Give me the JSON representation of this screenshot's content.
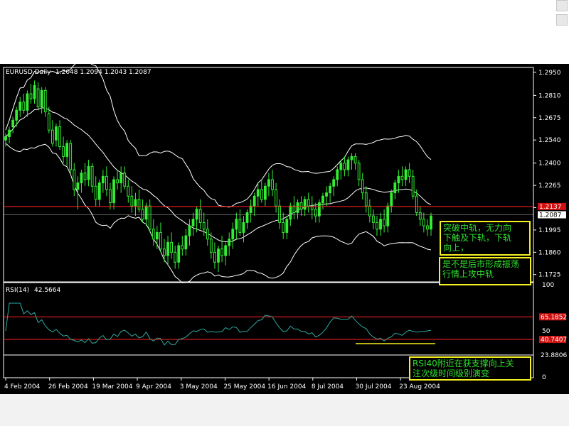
{
  "chart_data": {
    "type": "candlestick",
    "symbol_label": "EURUSD,Daily",
    "ohlc_label": "1.2048 1.2094 1.2043 1.2087",
    "price_ylim": [
      1.1685,
      1.2975
    ],
    "price_ticks": [
      "1.2950",
      "1.2810",
      "1.2675",
      "1.2540",
      "1.2400",
      "1.2265",
      "1.2130",
      "1.1995",
      "1.1860",
      "1.1725"
    ],
    "price_tick_values": [
      1.295,
      1.281,
      1.2675,
      1.254,
      1.24,
      1.2265,
      1.213,
      1.1995,
      1.186,
      1.1725
    ],
    "red_level_label": "1.2137",
    "red_level": 1.2137,
    "current_label": "1.2087",
    "current_price": 1.2087,
    "candles": [
      [
        1.254,
        1.258,
        1.25,
        1.256
      ],
      [
        1.256,
        1.262,
        1.252,
        1.26
      ],
      [
        1.262,
        1.268,
        1.258,
        1.266
      ],
      [
        1.266,
        1.274,
        1.262,
        1.272
      ],
      [
        1.272,
        1.28,
        1.268,
        1.277
      ],
      [
        1.277,
        1.282,
        1.27,
        1.272
      ],
      [
        1.272,
        1.284,
        1.268,
        1.282
      ],
      [
        1.282,
        1.288,
        1.276,
        1.279
      ],
      [
        1.279,
        1.29,
        1.276,
        1.287
      ],
      [
        1.285,
        1.289,
        1.272,
        1.274
      ],
      [
        1.274,
        1.286,
        1.27,
        1.284
      ],
      [
        1.284,
        1.286,
        1.268,
        1.271
      ],
      [
        1.27,
        1.274,
        1.258,
        1.26
      ],
      [
        1.26,
        1.266,
        1.25,
        1.252
      ],
      [
        1.254,
        1.264,
        1.25,
        1.262
      ],
      [
        1.262,
        1.266,
        1.248,
        1.25
      ],
      [
        1.25,
        1.256,
        1.24,
        1.244
      ],
      [
        1.244,
        1.254,
        1.238,
        1.252
      ],
      [
        1.252,
        1.254,
        1.234,
        1.236
      ],
      [
        1.236,
        1.24,
        1.22,
        1.224
      ],
      [
        1.224,
        1.232,
        1.212,
        1.228
      ],
      [
        1.228,
        1.236,
        1.222,
        1.234
      ],
      [
        1.234,
        1.24,
        1.226,
        1.23
      ],
      [
        1.23,
        1.242,
        1.226,
        1.238
      ],
      [
        1.238,
        1.24,
        1.222,
        1.226
      ],
      [
        1.226,
        1.232,
        1.214,
        1.218
      ],
      [
        1.218,
        1.23,
        1.214,
        1.228
      ],
      [
        1.228,
        1.236,
        1.222,
        1.232
      ],
      [
        1.232,
        1.238,
        1.22,
        1.224
      ],
      [
        1.224,
        1.228,
        1.212,
        1.216
      ],
      [
        1.216,
        1.232,
        1.212,
        1.23
      ],
      [
        1.23,
        1.236,
        1.224,
        1.228
      ],
      [
        1.228,
        1.238,
        1.222,
        1.234
      ],
      [
        1.234,
        1.238,
        1.224,
        1.226
      ],
      [
        1.226,
        1.23,
        1.216,
        1.22
      ],
      [
        1.22,
        1.226,
        1.21,
        1.214
      ],
      [
        1.214,
        1.222,
        1.208,
        1.218
      ],
      [
        1.218,
        1.224,
        1.21,
        1.212
      ],
      [
        1.212,
        1.218,
        1.204,
        1.206
      ],
      [
        1.206,
        1.216,
        1.202,
        1.214
      ],
      [
        1.214,
        1.218,
        1.198,
        1.2
      ],
      [
        1.2,
        1.206,
        1.19,
        1.194
      ],
      [
        1.194,
        1.202,
        1.188,
        1.198
      ],
      [
        1.198,
        1.204,
        1.186,
        1.188
      ],
      [
        1.188,
        1.194,
        1.18,
        1.184
      ],
      [
        1.184,
        1.196,
        1.178,
        1.192
      ],
      [
        1.192,
        1.198,
        1.182,
        1.186
      ],
      [
        1.186,
        1.19,
        1.176,
        1.18
      ],
      [
        1.18,
        1.192,
        1.176,
        1.19
      ],
      [
        1.19,
        1.196,
        1.184,
        1.188
      ],
      [
        1.188,
        1.2,
        1.184,
        1.196
      ],
      [
        1.196,
        1.206,
        1.19,
        1.202
      ],
      [
        1.202,
        1.21,
        1.196,
        1.206
      ],
      [
        1.206,
        1.214,
        1.198,
        1.212
      ],
      [
        1.212,
        1.218,
        1.2,
        1.204
      ],
      [
        1.204,
        1.21,
        1.196,
        1.2
      ],
      [
        1.2,
        1.206,
        1.19,
        1.194
      ],
      [
        1.194,
        1.198,
        1.182,
        1.186
      ],
      [
        1.186,
        1.192,
        1.176,
        1.18
      ],
      [
        1.18,
        1.19,
        1.174,
        1.188
      ],
      [
        1.188,
        1.196,
        1.18,
        1.184
      ],
      [
        1.184,
        1.192,
        1.178,
        1.19
      ],
      [
        1.19,
        1.198,
        1.184,
        1.194
      ],
      [
        1.194,
        1.204,
        1.188,
        1.2
      ],
      [
        1.2,
        1.21,
        1.194,
        1.206
      ],
      [
        1.206,
        1.212,
        1.196,
        1.198
      ],
      [
        1.198,
        1.208,
        1.192,
        1.204
      ],
      [
        1.204,
        1.212,
        1.2,
        1.21
      ],
      [
        1.21,
        1.218,
        1.204,
        1.214
      ],
      [
        1.214,
        1.222,
        1.208,
        1.22
      ],
      [
        1.22,
        1.228,
        1.214,
        1.224
      ],
      [
        1.224,
        1.23,
        1.216,
        1.218
      ],
      [
        1.218,
        1.228,
        1.214,
        1.226
      ],
      [
        1.226,
        1.234,
        1.22,
        1.23
      ],
      [
        1.23,
        1.236,
        1.22,
        1.224
      ],
      [
        1.224,
        1.228,
        1.21,
        1.214
      ],
      [
        1.214,
        1.218,
        1.2,
        1.204
      ],
      [
        1.204,
        1.21,
        1.194,
        1.198
      ],
      [
        1.198,
        1.208,
        1.194,
        1.206
      ],
      [
        1.206,
        1.216,
        1.202,
        1.214
      ],
      [
        1.214,
        1.22,
        1.206,
        1.21
      ],
      [
        1.21,
        1.218,
        1.206,
        1.216
      ],
      [
        1.216,
        1.22,
        1.208,
        1.212
      ],
      [
        1.212,
        1.22,
        1.208,
        1.218
      ],
      [
        1.218,
        1.222,
        1.21,
        1.214
      ],
      [
        1.214,
        1.22,
        1.206,
        1.212
      ],
      [
        1.212,
        1.216,
        1.204,
        1.208
      ],
      [
        1.208,
        1.218,
        1.204,
        1.216
      ],
      [
        1.216,
        1.222,
        1.212,
        1.22
      ],
      [
        1.22,
        1.226,
        1.214,
        1.222
      ],
      [
        1.222,
        1.228,
        1.216,
        1.226
      ],
      [
        1.226,
        1.232,
        1.22,
        1.23
      ],
      [
        1.23,
        1.238,
        1.226,
        1.236
      ],
      [
        1.236,
        1.242,
        1.23,
        1.24
      ],
      [
        1.24,
        1.244,
        1.232,
        1.236
      ],
      [
        1.236,
        1.244,
        1.232,
        1.242
      ],
      [
        1.242,
        1.246,
        1.236,
        1.244
      ],
      [
        1.244,
        1.246,
        1.236,
        1.24
      ],
      [
        1.24,
        1.242,
        1.226,
        1.23
      ],
      [
        1.23,
        1.234,
        1.218,
        1.222
      ],
      [
        1.222,
        1.226,
        1.21,
        1.214
      ],
      [
        1.214,
        1.218,
        1.204,
        1.208
      ],
      [
        1.208,
        1.212,
        1.2,
        1.204
      ],
      [
        1.204,
        1.208,
        1.196,
        1.2
      ],
      [
        1.2,
        1.21,
        1.196,
        1.206
      ],
      [
        1.206,
        1.212,
        1.198,
        1.202
      ],
      [
        1.202,
        1.216,
        1.198,
        1.214
      ],
      [
        1.214,
        1.224,
        1.21,
        1.222
      ],
      [
        1.222,
        1.23,
        1.218,
        1.228
      ],
      [
        1.228,
        1.236,
        1.222,
        1.232
      ],
      [
        1.232,
        1.238,
        1.226,
        1.23
      ],
      [
        1.23,
        1.238,
        1.226,
        1.236
      ],
      [
        1.236,
        1.24,
        1.228,
        1.232
      ],
      [
        1.232,
        1.236,
        1.218,
        1.22
      ],
      [
        1.22,
        1.224,
        1.208,
        1.21
      ],
      [
        1.21,
        1.214,
        1.202,
        1.206
      ],
      [
        1.206,
        1.21,
        1.198,
        1.202
      ],
      [
        1.202,
        1.206,
        1.196,
        1.2
      ],
      [
        1.2,
        1.21,
        1.196,
        1.208
      ]
    ],
    "rsi_label": "RSI(14)",
    "rsi_value_label": "42.5664",
    "rsi_ylim": [
      0,
      100
    ],
    "rsi_ticks": [
      "100",
      "50",
      "0"
    ],
    "rsi_upper_label": "65.1852",
    "rsi_upper": 65.1852,
    "rsi_lower_label": "40.7407",
    "rsi_lower": 40.7407,
    "rsi_support_label": "23.8806",
    "rsi_support": 23.8806,
    "x_labels": [
      "4 Feb 2004",
      "26 Feb 2004",
      "19 Mar 2004",
      "9 Apr 2004",
      "3 May 2004",
      "25 May 2004",
      "16 Jun 2004",
      "8 Jul 2004",
      "30 Jul 2004",
      "23 Aug 2004"
    ],
    "colors": {
      "background": "#000000",
      "candle": "#33ee33",
      "band": "#ffffff",
      "red_line": "#ff2020",
      "rsi_line": "#2fa8a0",
      "note_border": "#f5f020",
      "note_text": "#2ee02e"
    }
  },
  "annotations": {
    "note_1": "突破中轨，无力向\n下触及下轨，下轨\n向上，",
    "note_2": "是不是后市形成振荡\n行情上攻中轨",
    "note_3": "RSI40附近在获支撑向上关\n注次级时间级别演变"
  }
}
